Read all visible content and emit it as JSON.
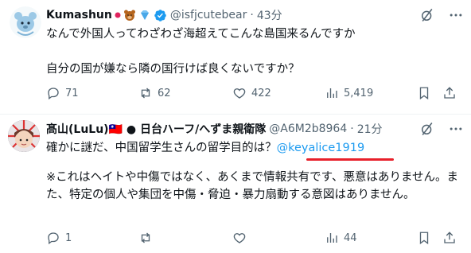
{
  "tweets": [
    {
      "name": "Kumashun",
      "handle": "@isfjcutebear",
      "time": "43分",
      "dot": "·",
      "line1": "なんで外国人ってわざわざ海超えてこんな島国来るんですか",
      "line2": "自分の国が嫌なら隣の国行けば良くないですか？",
      "stats": {
        "replies": "71",
        "reposts": "62",
        "likes": "422",
        "views": "5,419"
      }
    },
    {
      "name": "髙山(LuLu)🇹🇼 ● 日台ハーフ/へずま親衛隊",
      "handle": "@A6M2b8964",
      "time": "21分",
      "dot": "·",
      "line1_text": "確かに謎だ、中国留学生さんの留学目的は？",
      "mention": "@keyalice1919",
      "para": "※これはヘイトや中傷ではなく、あくまで情報共有です、悪意はありません。また、特定の個人や集団を中傷・脅迫・暴力扇動する意図はありません。",
      "stats": {
        "replies": "1",
        "reposts": "",
        "likes": "",
        "views": "44"
      }
    }
  ],
  "colors": {
    "accent": "#1d9bf0",
    "muted": "#536471",
    "underline": "#e8202a",
    "verified": "#1d9bf0"
  }
}
